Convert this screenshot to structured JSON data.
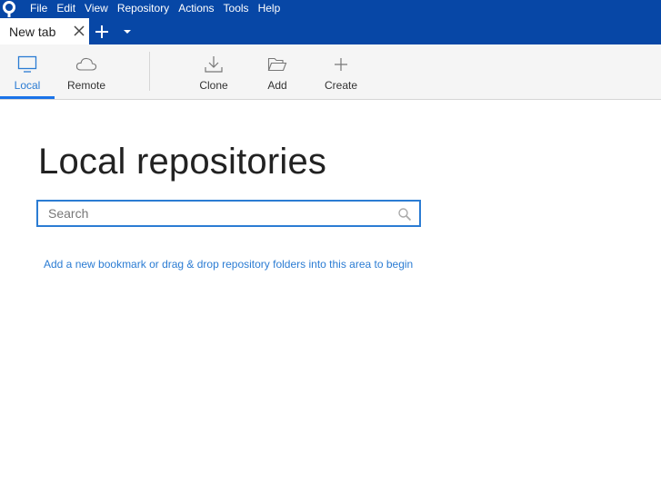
{
  "menubar": {
    "items": [
      "File",
      "Edit",
      "View",
      "Repository",
      "Actions",
      "Tools",
      "Help"
    ]
  },
  "tabs": {
    "active_title": "New tab"
  },
  "toolbar": {
    "local_label": "Local",
    "remote_label": "Remote",
    "clone_label": "Clone",
    "add_label": "Add",
    "create_label": "Create"
  },
  "main": {
    "title": "Local repositories",
    "search_placeholder": "Search",
    "hint": "Add a new bookmark or drag & drop repository folders into this area to begin"
  },
  "colors": {
    "header_bg": "#0747a6",
    "accent": "#2b7cd3"
  }
}
